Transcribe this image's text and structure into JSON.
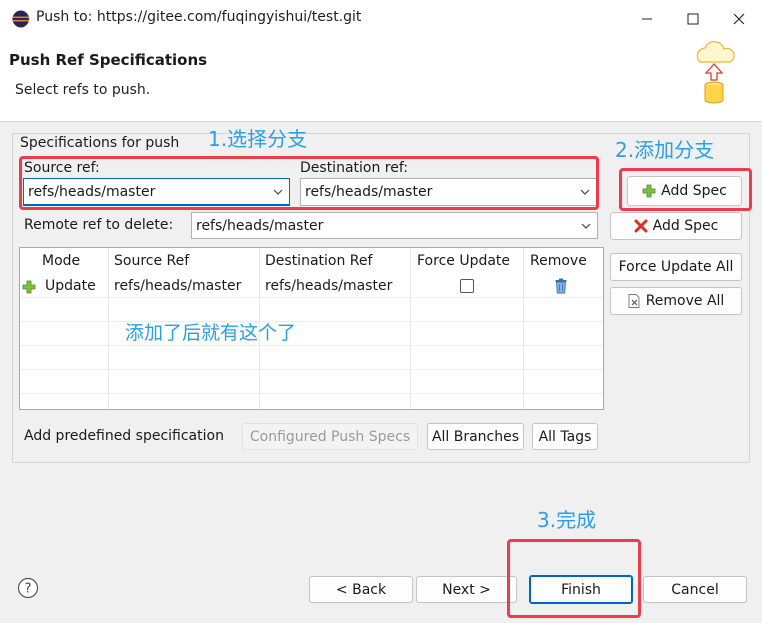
{
  "window": {
    "title": "Push to: https://gitee.com/fuqingyishui/test.git"
  },
  "header": {
    "title": "Push Ref Specifications",
    "subtitle": "Select refs to push."
  },
  "specs": {
    "group_label": "Specifications for push",
    "source_label": "Source ref:",
    "source_value": "refs/heads/master",
    "destination_label": "Destination ref:",
    "destination_value": "refs/heads/master",
    "remote_delete_label": "Remote ref to delete:",
    "remote_delete_value": "refs/heads/master",
    "add_spec_label": "Add Spec",
    "delete_spec_label": "Add Spec",
    "force_update_all_label": "Force Update All",
    "remove_all_label": "Remove All"
  },
  "table": {
    "columns": [
      "Mode",
      "Source Ref",
      "Destination Ref",
      "Force Update",
      "Remove"
    ],
    "rows": [
      {
        "mode": "Update",
        "source": "refs/heads/master",
        "destination": "refs/heads/master",
        "force": false
      }
    ]
  },
  "predefined": {
    "label": "Add predefined specification",
    "configured_label": "Configured Push Specs",
    "all_branches_label": "All Branches",
    "all_tags_label": "All Tags"
  },
  "footer": {
    "back_label": "< Back",
    "next_label": "Next >",
    "finish_label": "Finish",
    "cancel_label": "Cancel"
  },
  "annotations": {
    "step1": "1.选择分支",
    "step2": "2.添加分支",
    "note": "添加了后就有这个了",
    "step3": "3.完成"
  },
  "colors": {
    "annotation_text": "#2a9fe8",
    "annotation_box": "#ee3b4e",
    "focus_accent": "#0067c0"
  }
}
